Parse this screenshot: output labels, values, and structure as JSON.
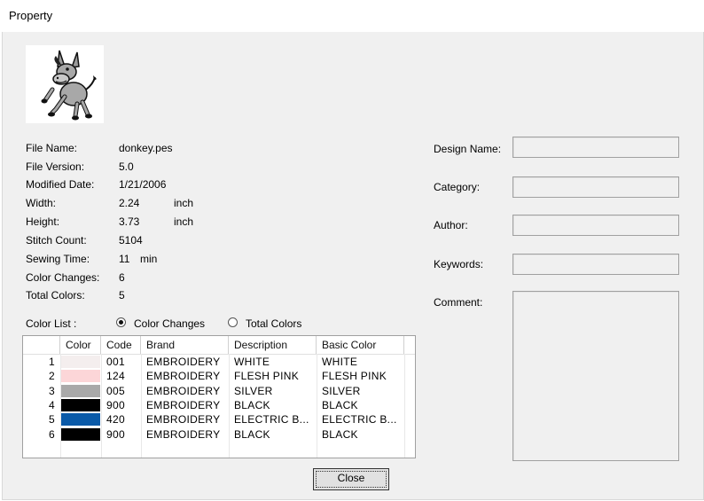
{
  "window": {
    "title": "Property"
  },
  "info": [
    {
      "label": "File Name:",
      "value": "donkey.pes",
      "unit": ""
    },
    {
      "label": "File Version:",
      "value": "5.0",
      "unit": ""
    },
    {
      "label": "Modified Date:",
      "value": "1/21/2006",
      "unit": ""
    },
    {
      "label": "Width:",
      "value": "2.24",
      "unit": "inch"
    },
    {
      "label": "Height:",
      "value": "3.73",
      "unit": "inch"
    },
    {
      "label": "Stitch Count:",
      "value": "5104",
      "unit": ""
    },
    {
      "label": "Sewing Time:",
      "value": "11",
      "unit": "min"
    },
    {
      "label": "Color Changes:",
      "value": "6",
      "unit": ""
    },
    {
      "label": "Total Colors:",
      "value": "5",
      "unit": ""
    }
  ],
  "design_fields": [
    {
      "label": "Design Name:",
      "value": ""
    },
    {
      "label": "Category:",
      "value": ""
    },
    {
      "label": "Author:",
      "value": ""
    },
    {
      "label": "Keywords:",
      "value": ""
    },
    {
      "label": "Comment:",
      "value": ""
    }
  ],
  "color_list": {
    "label": "Color List :",
    "options": [
      {
        "label": "Color Changes",
        "selected": true
      },
      {
        "label": "Total Colors",
        "selected": false
      }
    ],
    "columns": [
      "Color",
      "Code",
      "Brand",
      "Description",
      "Basic Color"
    ],
    "rows": [
      {
        "n": "1",
        "color": "#f4eeee",
        "code": "001",
        "brand": "EMBROIDERY",
        "desc": "WHITE",
        "basic": "WHITE"
      },
      {
        "n": "2",
        "color": "#fcd6d8",
        "code": "124",
        "brand": "EMBROIDERY",
        "desc": "FLESH PINK",
        "basic": "FLESH PINK"
      },
      {
        "n": "3",
        "color": "#a9a9a9",
        "code": "005",
        "brand": "EMBROIDERY",
        "desc": "SILVER",
        "basic": "SILVER"
      },
      {
        "n": "4",
        "color": "#000000",
        "code": "900",
        "brand": "EMBROIDERY",
        "desc": "BLACK",
        "basic": "BLACK"
      },
      {
        "n": "5",
        "color": "#0a5aa8",
        "code": "420",
        "brand": "EMBROIDERY",
        "desc": "ELECTRIC B...",
        "basic": "ELECTRIC B..."
      },
      {
        "n": "6",
        "color": "#000000",
        "code": "900",
        "brand": "EMBROIDERY",
        "desc": "BLACK",
        "basic": "BLACK"
      }
    ]
  },
  "buttons": {
    "close": "Close"
  },
  "thumbnail": {
    "icon": "donkey-icon"
  }
}
